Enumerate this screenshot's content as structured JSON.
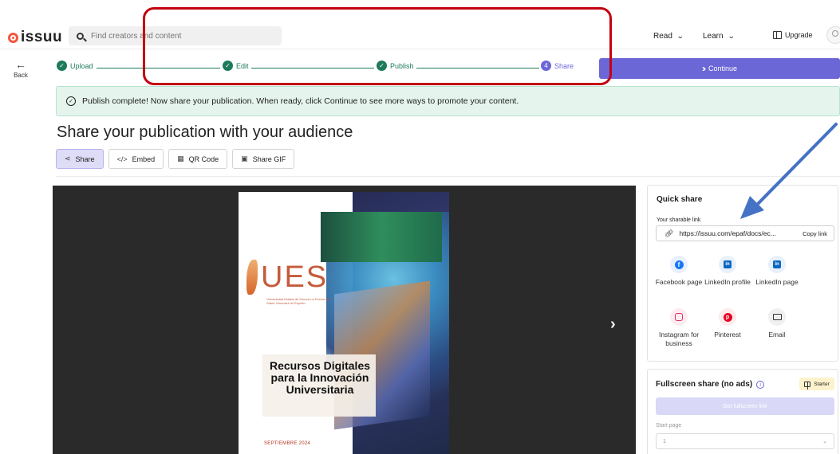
{
  "header": {
    "logo_text": "issuu",
    "search_placeholder": "Find creators and content",
    "nav_read": "Read",
    "nav_learn": "Learn",
    "upgrade": "Upgrade"
  },
  "back": {
    "label": "Back",
    "arrow": "←"
  },
  "stepper": {
    "steps": [
      {
        "label": "Upload",
        "state": "done"
      },
      {
        "label": "Edit",
        "state": "done"
      },
      {
        "label": "Publish",
        "state": "done"
      },
      {
        "label": "Share",
        "state": "current",
        "number": "4"
      }
    ],
    "continue_label": "Continue"
  },
  "banner": {
    "text": "Publish complete! Now share your publication. When ready, click Continue to see more ways to promote your content."
  },
  "page_title": "Share your publication with your audience",
  "tabs": [
    {
      "label": "Share",
      "icon": "share-icon",
      "active": true
    },
    {
      "label": "Embed",
      "icon": "code-icon",
      "active": false
    },
    {
      "label": "QR Code",
      "icon": "qr-icon",
      "active": false
    },
    {
      "label": "Share GIF",
      "icon": "gif-icon",
      "active": false
    }
  ],
  "publication": {
    "logo": "UES",
    "subtitle": "Universidad Estatal de Sonora\nLa Fuerza del Saber Generará mi Espíritu",
    "title": "Recursos Digitales para la Innovación Universitaria",
    "date": "SEPTIEMBRE 2024"
  },
  "quick_share": {
    "title": "Quick share",
    "link_label": "Your sharable link",
    "link_value": "https://issuu.com/epaf/docs/ec...",
    "copy_label": "Copy link",
    "items": [
      {
        "label": "Facebook page",
        "icon": "facebook-icon"
      },
      {
        "label": "LinkedIn profile",
        "icon": "linkedin-icon"
      },
      {
        "label": "LinkedIn page",
        "icon": "linkedin-icon"
      },
      {
        "label": "Instagram for business",
        "icon": "instagram-icon"
      },
      {
        "label": "Pinterest",
        "icon": "pinterest-icon"
      },
      {
        "label": "Email",
        "icon": "email-icon"
      }
    ]
  },
  "fullscreen": {
    "title": "Fullscreen share (no ads)",
    "badge": "Starter",
    "button": "Get fullscreen link",
    "start_label": "Start page",
    "start_value": "1"
  },
  "colors": {
    "accent": "#6b67d6",
    "success": "#1d7a5b",
    "annotation_red": "#c40010",
    "annotation_blue": "#4472c4"
  }
}
